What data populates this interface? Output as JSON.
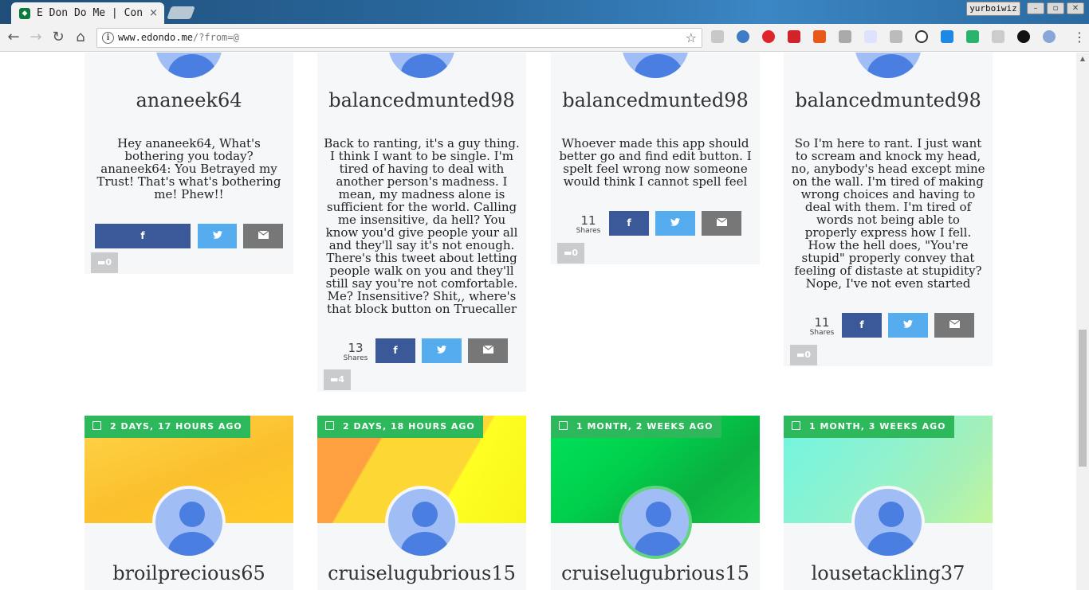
{
  "browser": {
    "tab_title": "E Don Do Me | Con",
    "tab_close": "×",
    "user_button": "yurboiwiz",
    "url_main": "www.edondo.me",
    "url_rest": "/?from=@"
  },
  "posts_row1": [
    {
      "username": "ananeek64",
      "text": "Hey ananeek64, What's bothering you today? ananeek64: You Betrayed my Trust! That's what's bothering me! Phew!!",
      "shares": "",
      "shares_label": "",
      "comments": "0"
    },
    {
      "username": "balancedmunted98",
      "text": "Back to ranting, it's a guy thing. I think I want to be single. I'm tired of having to deal with another person's madness. I mean, my madness alone is sufficient for the world. Calling me insensitive, da hell? You know you'd give people your all and they'll say it's not enough. There's this tweet about letting people walk on you and they'll still say you're not comfortable. Me? Insensitive? Shit,, where's that block button on Truecaller",
      "shares": "13",
      "shares_label": "Shares",
      "comments": "4"
    },
    {
      "username": "balancedmunted98",
      "text": "Whoever made this app should better go and find edit button. I spelt feel wrong now someone would think I cannot spell feel",
      "shares": "11",
      "shares_label": "Shares",
      "comments": "0"
    },
    {
      "username": "balancedmunted98",
      "text": "So I'm here to rant. I just want to scream and knock my head, no, anybody's head except mine on the wall. I'm tired of making wrong choices and having to deal with them. I'm tired of words not being able to properly express how I fell. How the hell does, \"You're stupid\" properly convey that feeling of distaste at stupidity? Nope, I've not even started",
      "shares": "11",
      "shares_label": "Shares",
      "comments": "0"
    }
  ],
  "posts_row2": [
    {
      "date": "2 DAYS, 17 HOURS AGO",
      "username": "broilprecious65",
      "theme": "#f9c42b"
    },
    {
      "date": "2 DAYS, 18 HOURS AGO",
      "username": "cruiselugubrious15",
      "theme": "#fbd13a"
    },
    {
      "date": "1 MONTH, 2 WEEKS AGO",
      "username": "cruiselugubrious15",
      "theme": "#11c548"
    },
    {
      "date": "1 MONTH, 3 WEEKS AGO",
      "username": "lousetackling37",
      "theme": "#86f0d0"
    }
  ],
  "icons": {
    "facebook": "f",
    "twitter": "twitter",
    "email": "email",
    "comment": "comment"
  },
  "colors": {
    "facebook": "#3b5998",
    "twitter": "#55acee",
    "email": "#777777",
    "date_badge": "#2eb85c"
  }
}
